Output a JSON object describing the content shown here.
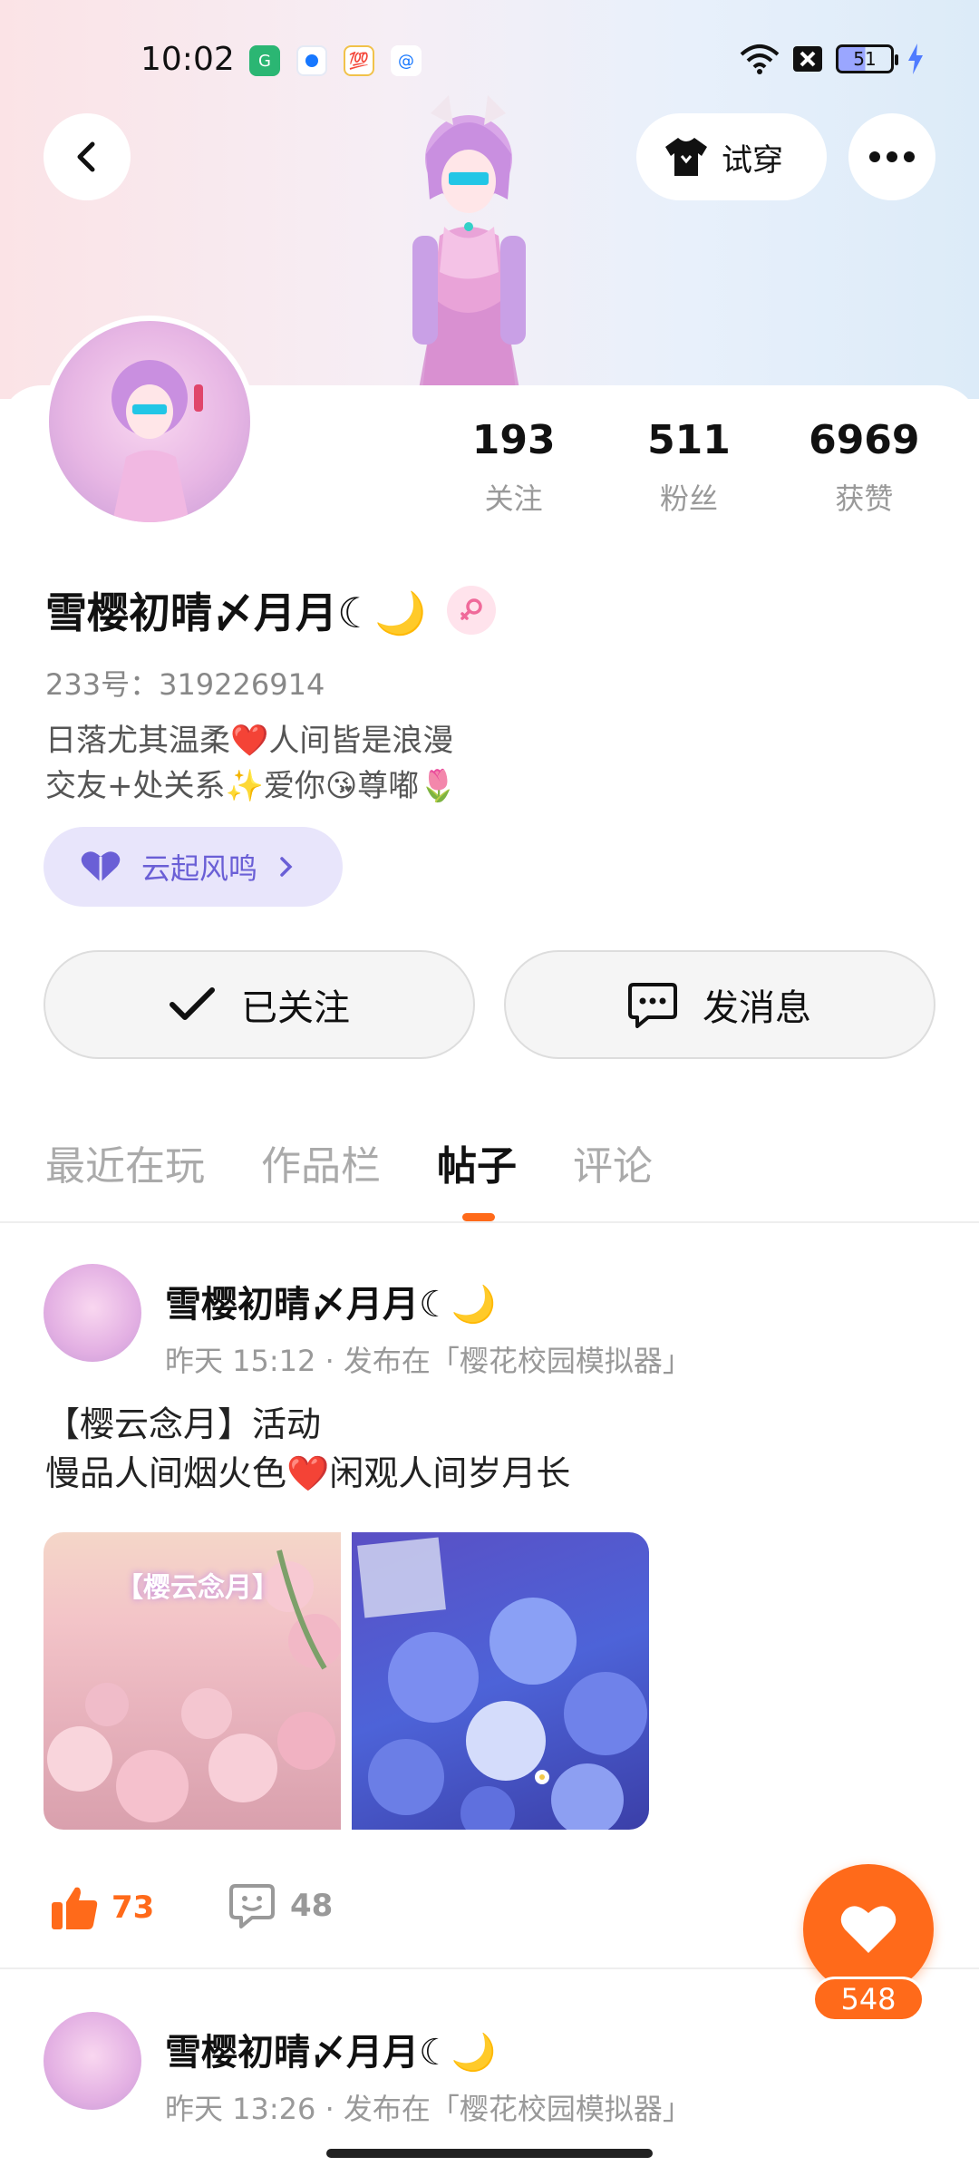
{
  "status_bar": {
    "time": "10:02",
    "battery": "51"
  },
  "header": {
    "tryon_label": "试穿"
  },
  "profile": {
    "stats": [
      {
        "value": "193",
        "label": "关注"
      },
      {
        "value": "511",
        "label": "粉丝"
      },
      {
        "value": "6969",
        "label": "获赞"
      }
    ],
    "name": "雪樱初晴〆月月☾🌙",
    "uid": "233号：319226914",
    "bio_line1": "日落尤其温柔❤️人间皆是浪漫",
    "bio_line2": "交友+处关系✨爱你😘尊嘟🌷",
    "club_label": "云起风鸣",
    "follow_label": "已关注",
    "message_label": "发消息"
  },
  "tabs": [
    "最近在玩",
    "作品栏",
    "帖子",
    "评论"
  ],
  "active_tab": "帖子",
  "posts": [
    {
      "author": "雪樱初晴〆月月☾🌙",
      "meta": "昨天 15:12 · 发布在「樱花校园模拟器」",
      "text_line1": "【樱云念月】活动",
      "text_line2": "慢品人间烟火色❤️闲观人间岁月长",
      "image1_caption": "【樱云念月】",
      "likes": "73",
      "comments": "48"
    },
    {
      "author": "雪樱初晴〆月月☾🌙",
      "meta": "昨天 13:26 · 发布在「樱花校园模拟器」"
    }
  ],
  "fab": {
    "count": "548"
  },
  "colors": {
    "accent": "#ff6a1a",
    "club_bg": "#e8e5fb",
    "club_text": "#6a5fd6"
  }
}
